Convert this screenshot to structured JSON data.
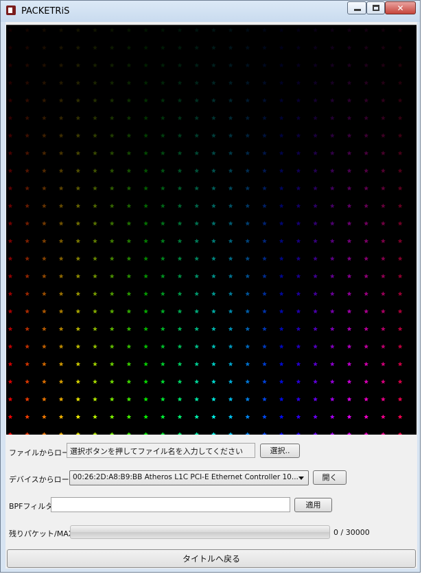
{
  "window": {
    "title": "PACKETRiS",
    "controls": {
      "minimize": "minimize",
      "maximize": "maximize",
      "close": "✕"
    }
  },
  "game_field": {
    "description_color": "#000000"
  },
  "file_load": {
    "label": "ファイルからロード",
    "value": "選択ボタンを押してファイル名を入力してください",
    "button": "選択.."
  },
  "device_load": {
    "label": "デバイスからロード",
    "selected": "00:26:2D:A8:B9:BB Atheros L1C PCI-E Ethernet Controller 10...",
    "button": "開く"
  },
  "bpf": {
    "label": "BPFフィルタ",
    "value": "",
    "button": "適用"
  },
  "remaining": {
    "label": "残りパケット/MAX",
    "progress_fraction": 0.0,
    "counter": "0 / 30000"
  },
  "footer": {
    "button": "タイトルへ戻る"
  },
  "colors": {
    "accent": "#06b025",
    "titlebar": "#d7e4f2",
    "close": "#c6453b"
  }
}
